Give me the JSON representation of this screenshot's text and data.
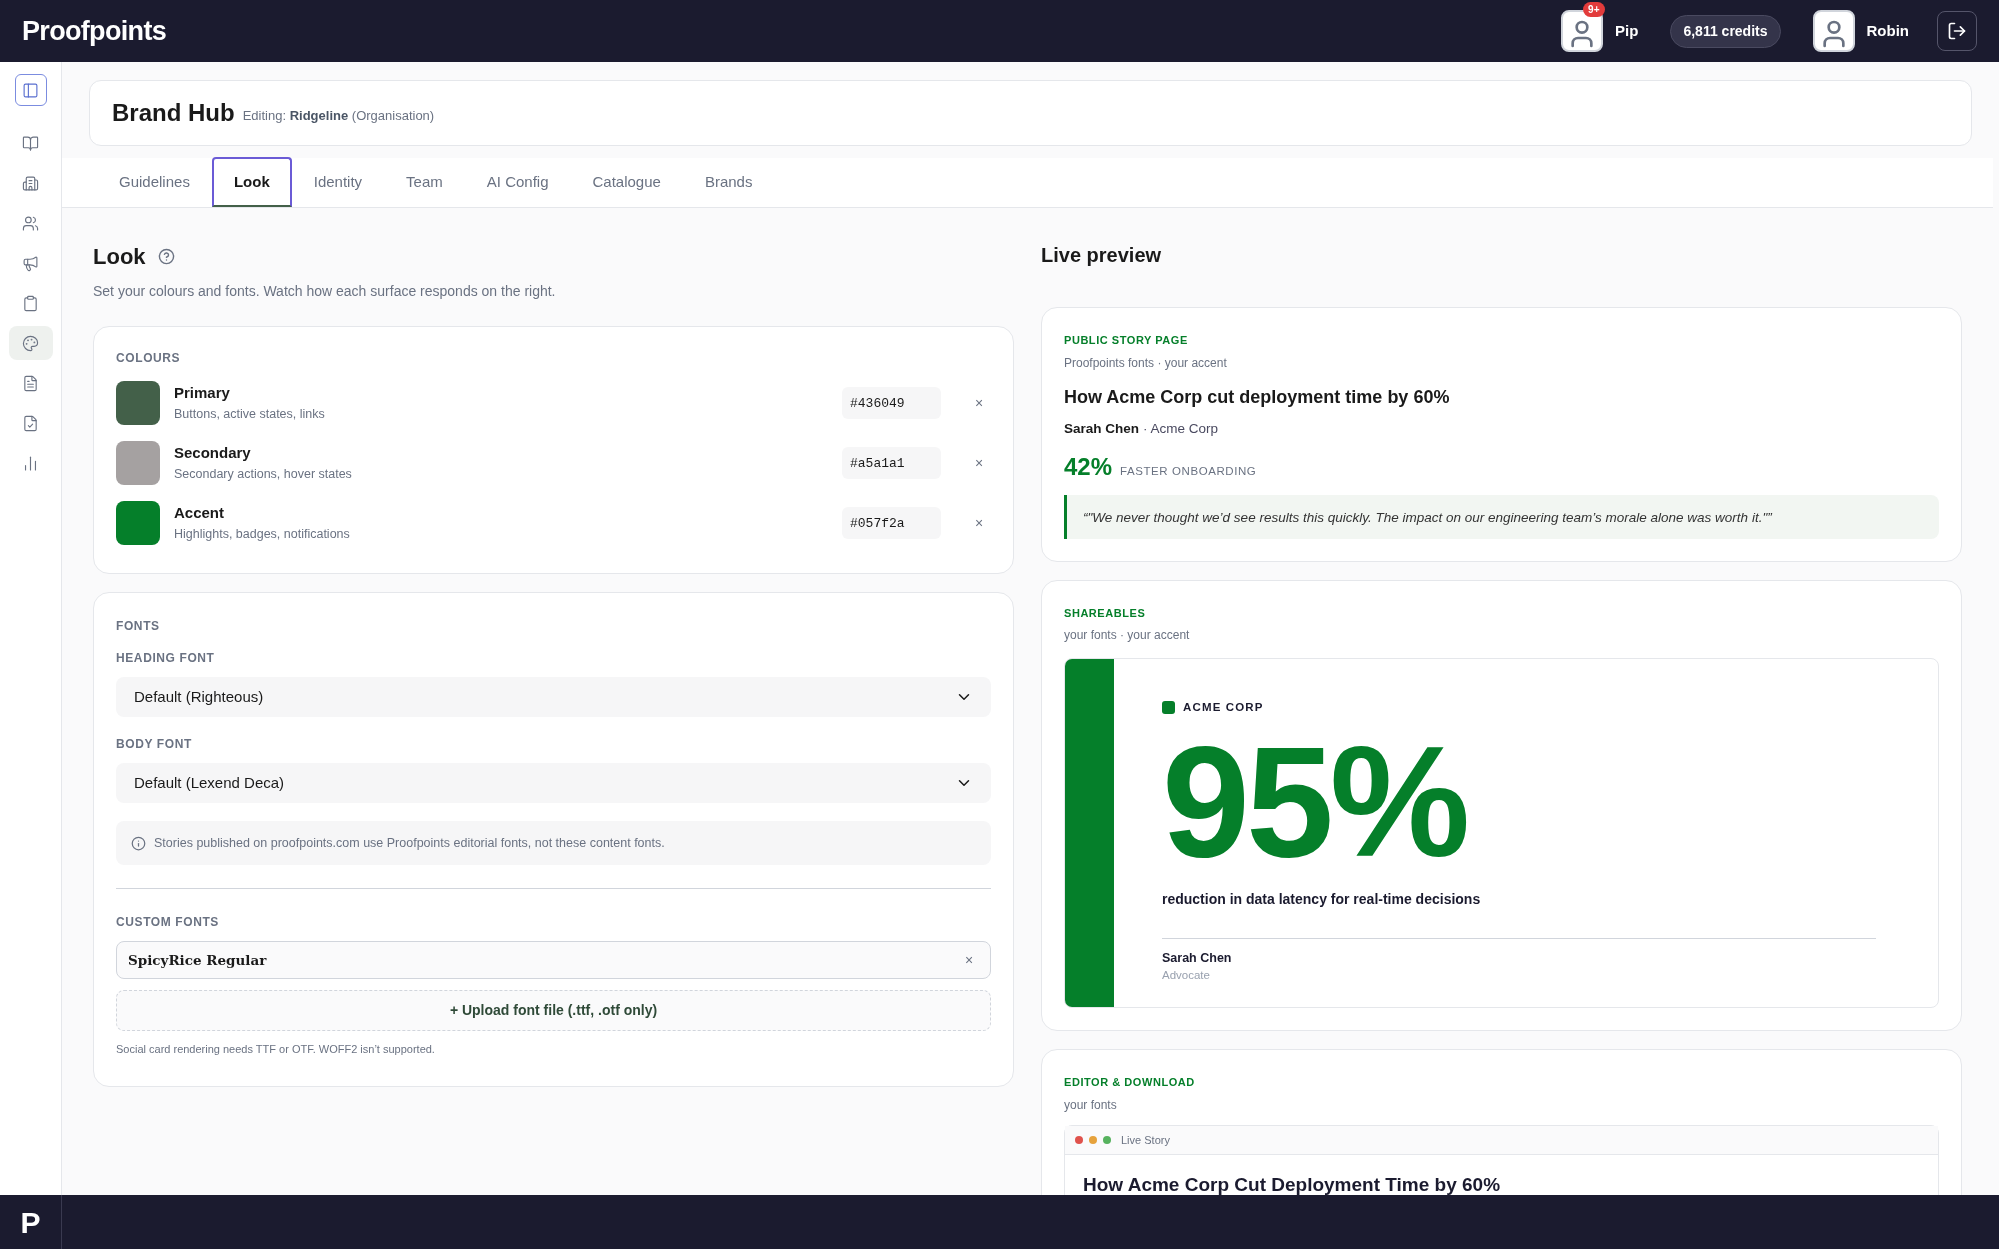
{
  "topbar": {
    "logo": "Proofpoints",
    "assistant": {
      "name": "Pip",
      "badge": "9+"
    },
    "credits": "6,811 credits",
    "user": {
      "name": "Robin"
    }
  },
  "sidebar": {
    "items": [
      {
        "kind": "toggle",
        "selected": false
      },
      {
        "kind": "book",
        "selected": false
      },
      {
        "kind": "building",
        "selected": false
      },
      {
        "kind": "users",
        "selected": false
      },
      {
        "kind": "megaphone",
        "selected": false
      },
      {
        "kind": "clipboard",
        "selected": false
      },
      {
        "kind": "palette",
        "selected": true
      },
      {
        "kind": "file",
        "selected": false
      },
      {
        "kind": "filecheck",
        "selected": false
      },
      {
        "kind": "chart",
        "selected": false
      }
    ]
  },
  "header": {
    "title": "Brand Hub",
    "editing_label": "Editing:",
    "editing_org": "Ridgeline",
    "editing_suffix": "(Organisation)"
  },
  "tabs": [
    {
      "label": "Guidelines",
      "selected": false
    },
    {
      "label": "Look",
      "selected": true
    },
    {
      "label": "Identity",
      "selected": false
    },
    {
      "label": "Team",
      "selected": false
    },
    {
      "label": "AI Config",
      "selected": false
    },
    {
      "label": "Catalogue",
      "selected": false
    },
    {
      "label": "Brands",
      "selected": false
    }
  ],
  "look": {
    "title": "Look",
    "subtitle": "Set your colours and fonts. Watch how each surface responds on the right.",
    "colours": {
      "heading": "COLOURS",
      "items": [
        {
          "name": "Primary",
          "description": "Buttons, active states, links",
          "value": "#436049",
          "color": "#436049",
          "clear": "×"
        },
        {
          "name": "Secondary",
          "description": "Secondary actions, hover states",
          "value": "#a5a1a1",
          "color": "#a5a1a1",
          "clear": "×"
        },
        {
          "name": "Accent",
          "description": "Highlights, badges, notifications",
          "value": "#057f2a",
          "color": "#057f2a",
          "clear": "×"
        }
      ]
    },
    "fonts": {
      "heading": "FONTS",
      "heading_font": {
        "label": "HEADING FONT",
        "value": "Default (Righteous)"
      },
      "body_font": {
        "label": "BODY FONT",
        "value": "Default (Lexend Deca)"
      },
      "note": "Stories published on proofpoints.com use Proofpoints editorial fonts, not these content fonts.",
      "custom_heading": "CUSTOM FONTS",
      "custom_fonts": [
        {
          "name": "SpicyRice Regular",
          "remove": "×"
        }
      ],
      "upload": "+ Upload font file (.ttf, .otf only)",
      "hint": "Social card rendering needs TTF or OTF. WOFF2 isn’t supported."
    }
  },
  "preview": {
    "title": "Live preview",
    "story": {
      "label": "PUBLIC STORY PAGE",
      "sub": "Proofpoints fonts · your accent",
      "headline": "How Acme Corp cut deployment time by 60%",
      "author": "Sarah Chen",
      "company": "· Acme Corp",
      "stat": "42%",
      "stat_label": "FASTER ONBOARDING",
      "quote": "“\"We never thought we’d see results this quickly. The impact on our engineering team’s morale alone was worth it.\"”"
    },
    "shareables": {
      "label": "SHAREABLES",
      "sub": "your fonts · your accent",
      "brand": "ACME CORP",
      "stat": "95%",
      "caption": "reduction in data latency for real-time decisions",
      "person": "Sarah Chen",
      "role": "Advocate"
    },
    "editor": {
      "label": "EDITOR & DOWNLOAD",
      "sub": "your fonts",
      "window_title": "Live Story",
      "headline": "How Acme Corp Cut Deployment Time by 60%"
    }
  },
  "footer": {
    "logo": "P"
  }
}
